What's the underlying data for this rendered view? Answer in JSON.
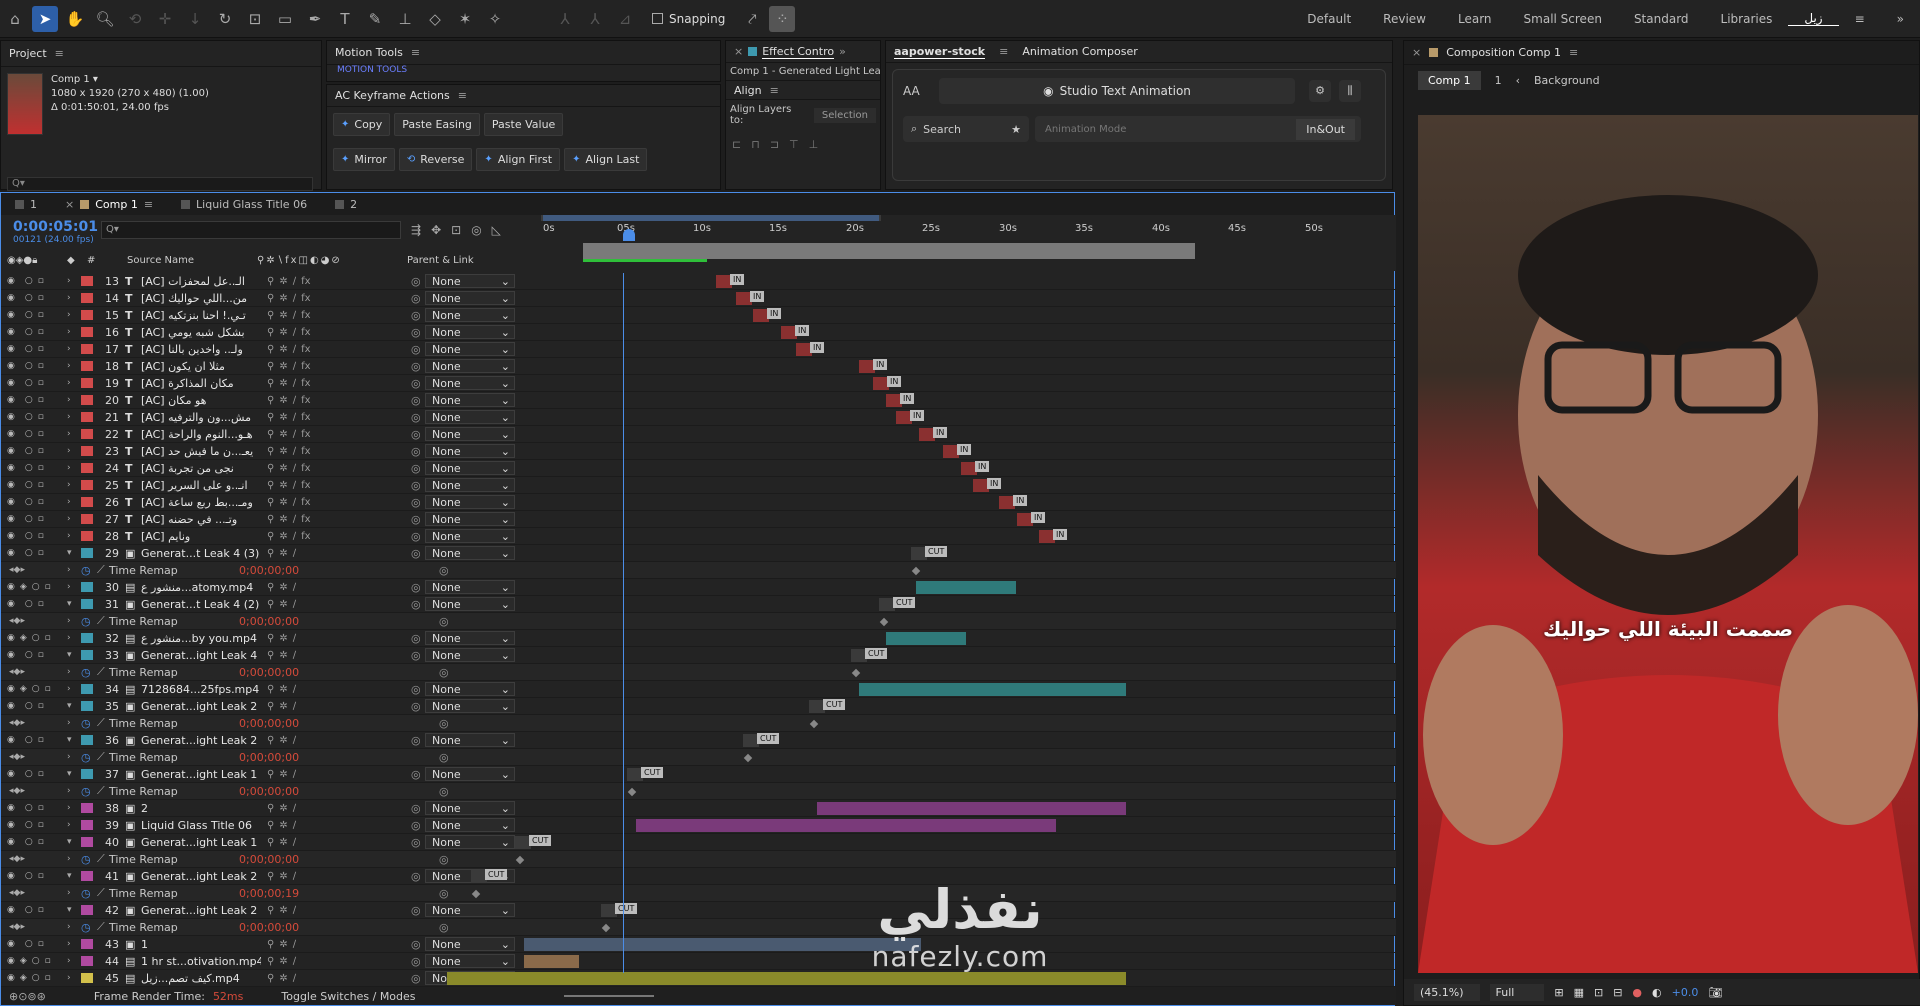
{
  "toolbar": {
    "snapping_label": "Snapping",
    "workspaces": [
      "Default",
      "Review",
      "Learn",
      "Small Screen",
      "Standard",
      "Libraries",
      "زيل"
    ]
  },
  "project": {
    "title": "Project",
    "comp_name": "Comp 1 ▾",
    "comp_size": "1080 x 1920  (270 x 480) (1.00)",
    "comp_duration": "Δ 0:01:50:01, 24.00 fps",
    "search_placeholder": "Q▾"
  },
  "motion_tools": {
    "title": "Motion Tools",
    "tab_label": "MOTION TOOLS"
  },
  "ac_keyframe": {
    "title": "AC Keyframe Actions",
    "row1": [
      "Copy",
      "Paste Easing",
      "Paste Value"
    ],
    "row2": [
      "Mirror",
      "Reverse",
      "Align First",
      "Align Last"
    ]
  },
  "effect_controls": {
    "tab_label": "Effect Contro",
    "subtitle": "Comp 1 - Generated Light Lea",
    "align_title": "Align",
    "align_to_label": "Align Layers to:",
    "align_to_value": "Selection"
  },
  "aapower": {
    "tab_label": "aapower-stock",
    "tab2_label": "Animation Composer",
    "aa_label": "AA",
    "studio_btn": "Studio Text Animation",
    "search_label": "Search",
    "mode_placeholder": "Animation Mode",
    "inout_label": "In&Out"
  },
  "composition": {
    "title": "Composition Comp 1",
    "crumb1": "Comp 1",
    "crumb2": "1",
    "crumb3": "Background",
    "caption": "صممت البيئة اللي حواليك",
    "watermark_ar": "نفذلي",
    "watermark_en": "nafezly.com",
    "zoom": "(45.1%)",
    "quality": "Full",
    "exposure": "+0.0"
  },
  "timeline": {
    "tabs": [
      "1",
      "Comp 1",
      "Liquid Glass Title 06",
      "2"
    ],
    "timecode": "0:00:05:01",
    "frame_info": "00121 (24.00 fps)",
    "search_placeholder": "Q▾",
    "col_source": "Source Name",
    "col_parent": "Parent & Link",
    "ticks": [
      "0s",
      "05s",
      "10s",
      "15s",
      "20s",
      "25s",
      "30s",
      "35s",
      "40s",
      "45s",
      "50s"
    ],
    "footer_render": "Frame Render Time:",
    "footer_render_val": "52ms",
    "footer_toggle": "Toggle Switches / Modes",
    "time_remap_label": "Time Remap",
    "time_remap_value": "0;00;00;00",
    "parent_none": "None",
    "layers": [
      {
        "num": "13",
        "name": "[AC] الـ..عل لمحفزات",
        "type": "T",
        "color": "#d24b4b",
        "marker": "IN",
        "mx": 725
      },
      {
        "num": "14",
        "name": "[AC] من...اللي حواليك",
        "type": "T",
        "color": "#d24b4b",
        "marker": "IN",
        "mx": 745
      },
      {
        "num": "15",
        "name": "[AC] تـي.! احنا بنزتكيه",
        "type": "T",
        "color": "#d24b4b",
        "marker": "IN",
        "mx": 762
      },
      {
        "num": "16",
        "name": "[AC] بشكل شبه يومي",
        "type": "T",
        "color": "#d24b4b",
        "marker": "IN",
        "mx": 790
      },
      {
        "num": "17",
        "name": "[AC] ولـ.. واخدين بالنا",
        "type": "T",
        "color": "#d24b4b",
        "marker": "IN",
        "mx": 805
      },
      {
        "num": "18",
        "name": "[AC] مثلا ان يكون",
        "type": "T",
        "color": "#d24b4b",
        "marker": "IN",
        "mx": 868
      },
      {
        "num": "19",
        "name": "[AC] مكان المذاكرة",
        "type": "T",
        "color": "#d24b4b",
        "marker": "IN",
        "mx": 882
      },
      {
        "num": "20",
        "name": "[AC] هو مكان",
        "type": "T",
        "color": "#d24b4b",
        "marker": "IN",
        "mx": 895
      },
      {
        "num": "21",
        "name": "[AC] مش...ون والترفيه",
        "type": "T",
        "color": "#d24b4b",
        "marker": "IN",
        "mx": 905
      },
      {
        "num": "22",
        "name": "[AC] هـو...النوم والراحة",
        "type": "T",
        "color": "#d24b4b",
        "marker": "IN",
        "mx": 928
      },
      {
        "num": "23",
        "name": "[AC] يعـ...ن ما فيش حد",
        "type": "T",
        "color": "#d24b4b",
        "marker": "IN",
        "mx": 952
      },
      {
        "num": "24",
        "name": "[AC] نجى من تجربة",
        "type": "T",
        "color": "#d24b4b",
        "marker": "IN",
        "mx": 970
      },
      {
        "num": "25",
        "name": "[AC] انـ..و على السرير",
        "type": "T",
        "color": "#d24b4b",
        "marker": "IN",
        "mx": 982
      },
      {
        "num": "26",
        "name": "[AC] ومـ...بط ربع ساعة",
        "type": "T",
        "color": "#d24b4b",
        "marker": "IN",
        "mx": 1008
      },
      {
        "num": "27",
        "name": "[AC] وتـ... في حضنه",
        "type": "T",
        "color": "#d24b4b",
        "marker": "IN",
        "mx": 1026
      },
      {
        "num": "28",
        "name": "[AC] ونايم",
        "type": "T",
        "color": "#d24b4b",
        "marker": "IN",
        "mx": 1048
      },
      {
        "num": "29",
        "name": "Generat...t Leak 4 (3)",
        "type": "C",
        "color": "#3e9ab0",
        "marker": "CUT",
        "mx": 920,
        "tr": true
      },
      {
        "num": "30",
        "name": "منشور ع...atomy.mp4",
        "type": "V",
        "color": "#3e9ab0",
        "bar": [
          915,
          1015,
          "#2f7a7a"
        ]
      },
      {
        "num": "31",
        "name": "Generat...t Leak 4 (2)",
        "type": "C",
        "color": "#3e9ab0",
        "marker": "CUT",
        "mx": 888,
        "tr": true
      },
      {
        "num": "32",
        "name": "منشور ع...by you.mp4",
        "type": "V",
        "color": "#3e9ab0",
        "bar": [
          885,
          965,
          "#2f7a7a"
        ]
      },
      {
        "num": "33",
        "name": "Generat...ight Leak 4",
        "type": "C",
        "color": "#3e9ab0",
        "marker": "CUT",
        "mx": 860,
        "tr": true
      },
      {
        "num": "34",
        "name": "7128684...25fps.mp4",
        "type": "V",
        "color": "#3e9ab0",
        "bar": [
          858,
          1125,
          "#2f7a7a"
        ]
      },
      {
        "num": "35",
        "name": "Generat...ight Leak 2",
        "type": "C",
        "color": "#3e9ab0",
        "marker": "CUT",
        "mx": 818,
        "tr": true
      },
      {
        "num": "36",
        "name": "Generat...ight Leak 2",
        "type": "C",
        "color": "#3e9ab0",
        "marker": "CUT",
        "mx": 752,
        "tr": true
      },
      {
        "num": "37",
        "name": "Generat...ight Leak 1",
        "type": "C",
        "color": "#3e9ab0",
        "marker": "CUT",
        "mx": 636,
        "tr": true
      },
      {
        "num": "38",
        "name": "2",
        "type": "C",
        "color": "#b04aa0",
        "bar": [
          816,
          1125,
          "#7a3a7a"
        ]
      },
      {
        "num": "39",
        "name": "Liquid Glass Title 06",
        "type": "C",
        "color": "#b04aa0",
        "bar": [
          635,
          1055,
          "#7a3a7a"
        ]
      },
      {
        "num": "40",
        "name": "Generat...ight Leak 1",
        "type": "C",
        "color": "#b04aa0",
        "marker": "CUT",
        "mx": 524,
        "tr": true
      },
      {
        "num": "41",
        "name": "Generat...ight Leak 2",
        "type": "C",
        "color": "#b04aa0",
        "marker": "CUT",
        "mx": 480,
        "tr": true,
        "trv": "0;00;00;19"
      },
      {
        "num": "42",
        "name": "Generat...ight Leak 2",
        "type": "C",
        "color": "#b04aa0",
        "marker": "CUT",
        "mx": 610,
        "tr": true
      },
      {
        "num": "43",
        "name": "1",
        "type": "C",
        "color": "#b04aa0",
        "bar": [
          523,
          920,
          "#4a5a70"
        ]
      },
      {
        "num": "44",
        "name": "1 hr st...otivation.mp4",
        "type": "V",
        "color": "#b04aa0",
        "bar": [
          523,
          578,
          "#8a6a4a"
        ]
      },
      {
        "num": "45",
        "name": "كيف تصم...زيل.mp4",
        "type": "V",
        "color": "#d2c04b",
        "bar": [
          446,
          1125,
          "#8a8a2a"
        ]
      }
    ]
  }
}
